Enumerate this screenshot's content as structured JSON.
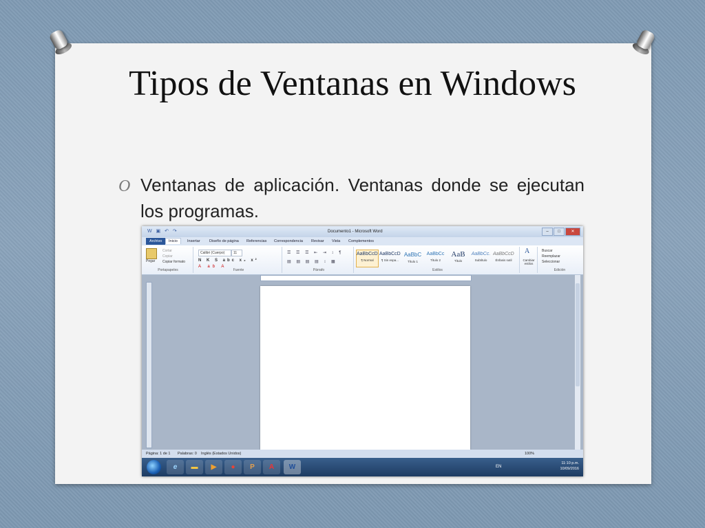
{
  "slide": {
    "title": "Tipos de Ventanas en Windows",
    "bullet_mark": "O",
    "bullet_bold": "Ventanas de aplicación.",
    "bullet_rest": " Ventanas donde se ejecutan los programas."
  },
  "word": {
    "window_title": "Documento1 - Microsoft Word",
    "tabs": [
      "Archivo",
      "Inicio",
      "Insertar",
      "Diseño de página",
      "Referencias",
      "Correspondencia",
      "Revisar",
      "Vista",
      "Complementos"
    ],
    "clipboard": {
      "paste": "Pegar",
      "cut": "Cortar",
      "copy": "Copiar",
      "format": "Copiar formato",
      "label": "Portapapeles"
    },
    "font": {
      "name": "Calibri (Cuerpo)",
      "size": "11",
      "label": "Fuente"
    },
    "paragraph_label": "Párrafo",
    "styles": [
      {
        "sample": "AaBbCcDc",
        "name": "¶ Normal"
      },
      {
        "sample": "AaBbCcDc",
        "name": "¶ Sin espa..."
      },
      {
        "sample": "AaBbC",
        "name": "Título 1"
      },
      {
        "sample": "AaBbCc",
        "name": "Título 2"
      },
      {
        "sample": "AaB",
        "name": "Título"
      },
      {
        "sample": "AaBbCc.",
        "name": "Subtítulo"
      },
      {
        "sample": "AaBbCcDc",
        "name": "Énfasis sutil"
      }
    ],
    "styles_label": "Estilos",
    "change_styles": "Cambiar estilos",
    "editing": {
      "find": "Buscar",
      "replace": "Reemplazar",
      "select": "Seleccionar",
      "label": "Edición"
    },
    "status": {
      "page": "Página: 1 de 1",
      "words": "Palabras: 0",
      "lang": "Inglés (Estados Unidos)",
      "zoom": "100%"
    },
    "tray": {
      "lang": "EN",
      "time": "11:10 p.m.",
      "date": "10/09/2016"
    }
  }
}
